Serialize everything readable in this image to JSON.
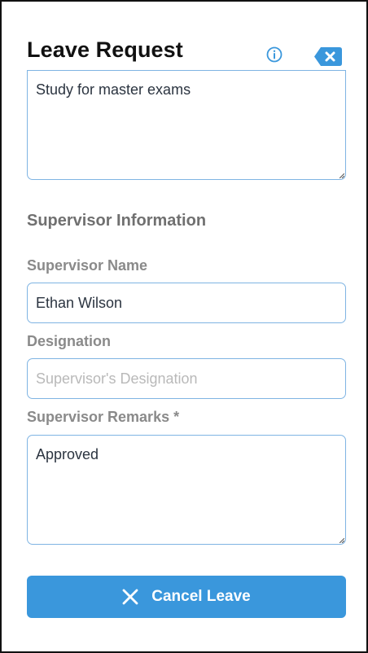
{
  "header": {
    "title": "Leave Request",
    "info_icon": "info-icon",
    "clear_icon": "backspace-clear-icon"
  },
  "reason": {
    "value": "Study for master exams"
  },
  "supervisor": {
    "section_title": "Supervisor Information",
    "name_label": "Supervisor Name",
    "name_value": "Ethan Wilson",
    "designation_label": "Designation",
    "designation_placeholder": "Supervisor's Designation",
    "remarks_label": "Supervisor Remarks *",
    "remarks_value": "Approved"
  },
  "actions": {
    "cancel_label": "Cancel Leave",
    "cancel_icon": "close-icon"
  },
  "colors": {
    "accent": "#3a97dc",
    "field_border": "#7fb4e3",
    "label": "#8a8a8a"
  }
}
